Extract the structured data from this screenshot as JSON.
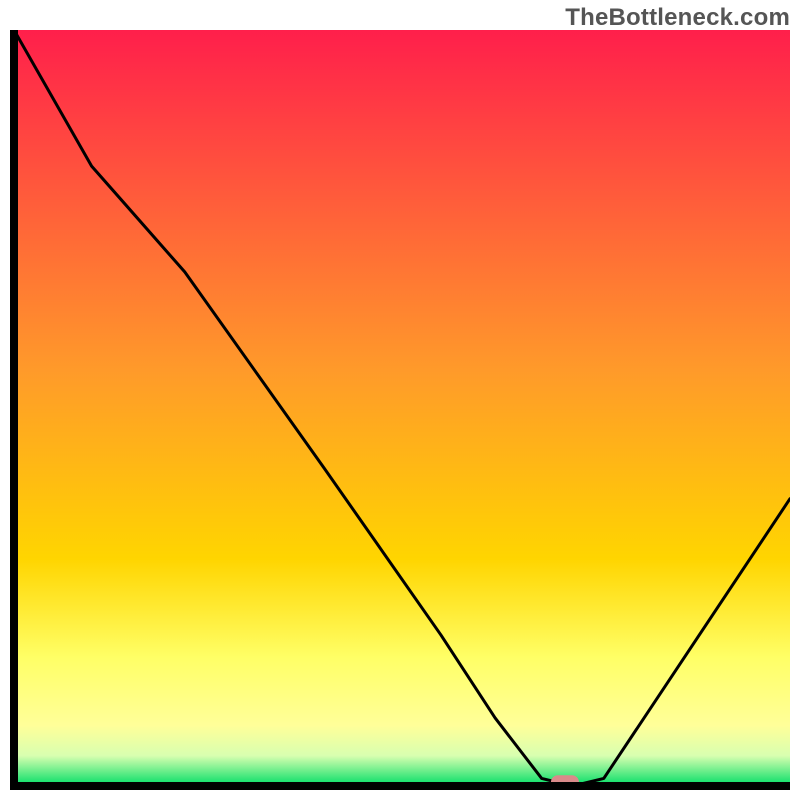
{
  "watermark": "TheBottleneck.com",
  "colors": {
    "axis": "#000000",
    "curve": "#000000",
    "marker_fill": "#d98a8a",
    "gradient_top": "#ff1f4b",
    "gradient_mid": "#ffd500",
    "gradient_low_yellow": "#ffff99",
    "gradient_green": "#00dd66"
  },
  "chart_data": {
    "type": "line",
    "title": "",
    "xlabel": "",
    "ylabel": "",
    "xlim": [
      0,
      100
    ],
    "ylim": [
      0,
      100
    ],
    "x": [
      0,
      10,
      22,
      40,
      55,
      62,
      68,
      72,
      76,
      100
    ],
    "y": [
      100,
      82,
      68,
      42,
      20,
      9,
      1,
      0,
      1,
      38
    ],
    "marker": {
      "x": 71,
      "y": 0.5
    }
  }
}
